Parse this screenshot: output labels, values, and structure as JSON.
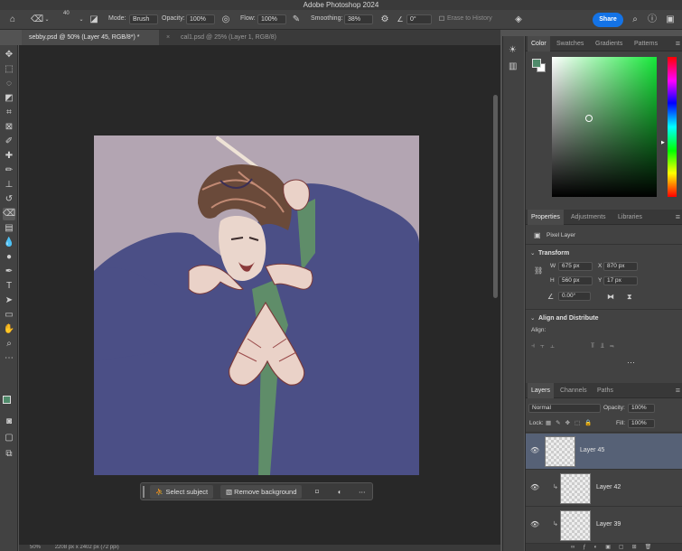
{
  "window": {
    "title": "Adobe Photoshop 2024"
  },
  "options_bar": {
    "brush_size": "40",
    "mode_label": "Mode:",
    "mode_value": "Brush",
    "opacity_label": "Opacity:",
    "opacity_value": "100%",
    "flow_label": "Flow:",
    "flow_value": "100%",
    "smoothing_label": "Smoothing:",
    "smoothing_value": "38%",
    "angle_value": "0°",
    "erase_history_label": "Erase to History",
    "share_label": "Share"
  },
  "document_tabs": [
    {
      "label": "sebby.psd @ 50% (Layer 45, RGB/8*) *",
      "active": true
    },
    {
      "label": "cal1.psd @ 25% (Layer 1, RGB/8)",
      "active": false
    }
  ],
  "contextual_taskbar": {
    "select_subject": "Select subject",
    "remove_background": "Remove background"
  },
  "status_bar": {
    "zoom": "50%",
    "doc_info": "2208 px x 2402 px (72 ppi)"
  },
  "color_panel": {
    "tabs": [
      "Color",
      "Swatches",
      "Gradients",
      "Patterns"
    ],
    "foreground": "#4f8a6a",
    "background": "#ffffff"
  },
  "properties_panel": {
    "tabs": [
      "Properties",
      "Adjustments",
      "Libraries"
    ],
    "layer_type": "Pixel Layer",
    "transform_heading": "Transform",
    "w_label": "W",
    "w_value": "675 px",
    "h_label": "H",
    "h_value": "560 px",
    "x_label": "X",
    "x_value": "870 px",
    "y_label": "Y",
    "y_value": "17 px",
    "angle_value": "0.00°",
    "align_heading": "Align and Distribute",
    "align_label": "Align:"
  },
  "layers_panel": {
    "tabs": [
      "Layers",
      "Channels",
      "Paths"
    ],
    "blend_mode": "Normal",
    "opacity_label": "Opacity:",
    "opacity_value": "100%",
    "lock_label": "Lock:",
    "fill_label": "Fill:",
    "fill_value": "100%",
    "layers": [
      {
        "name": "Layer 45",
        "selected": true
      },
      {
        "name": "Layer 42",
        "selected": false
      },
      {
        "name": "Layer 39",
        "selected": false
      }
    ]
  },
  "colors": {
    "accent": "#1473e6",
    "canvas_background": "#b3a5b2",
    "jacket": "#4b4f86",
    "tie": "#5f8d69"
  }
}
